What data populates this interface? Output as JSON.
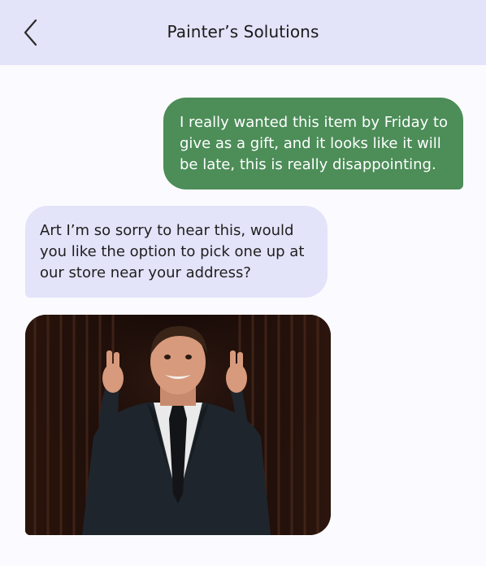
{
  "header": {
    "title": "Painter’s Solutions",
    "back_icon": "chevron-left-icon"
  },
  "messages": [
    {
      "direction": "outgoing",
      "text": "I really wanted this item by Friday to give as a gift, and it looks like it will be late, this is really disappointing."
    },
    {
      "direction": "incoming",
      "text": "Art I’m so sorry to hear this, would you like the option to pick one up at our store near your address?"
    }
  ],
  "gif": {
    "description_icon": "gif-image"
  },
  "colors": {
    "header_bg": "#e3e3f9",
    "outgoing_bubble": "#4c8d58",
    "incoming_bubble": "#e3e3f9",
    "page_bg": "#fbfbff"
  }
}
